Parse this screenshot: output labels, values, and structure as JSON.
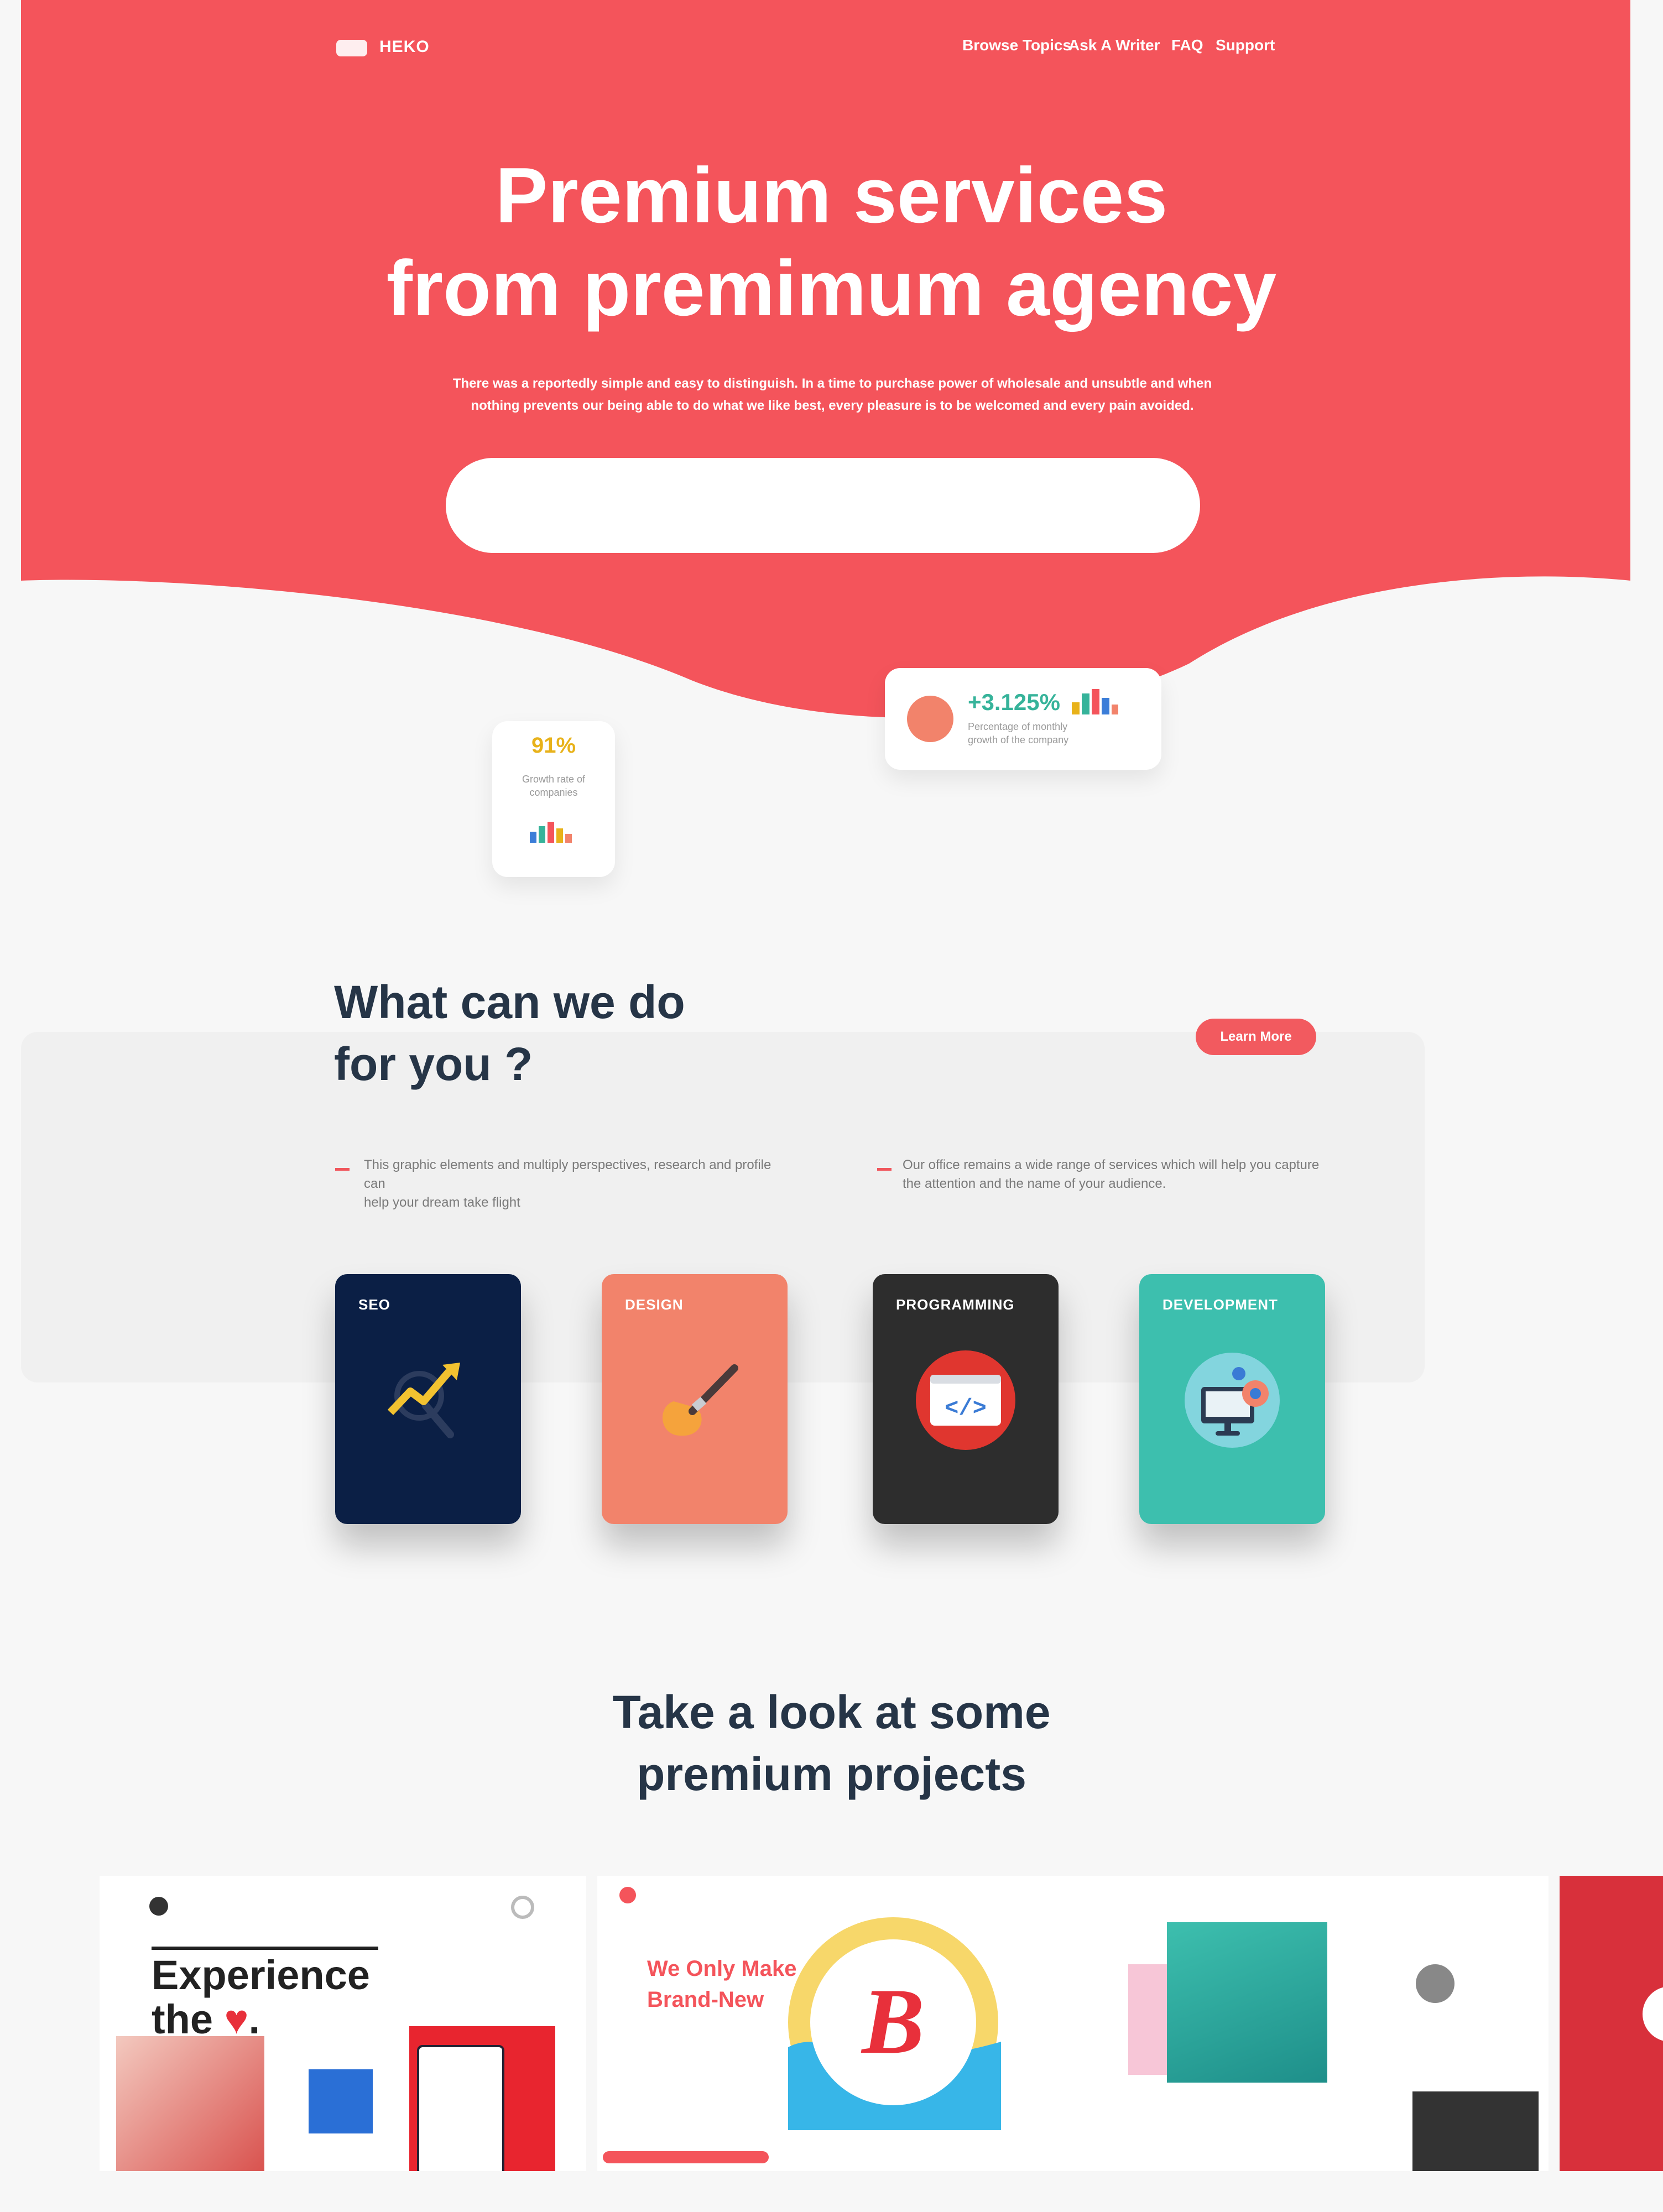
{
  "brand": {
    "name": "HEKO"
  },
  "nav": {
    "items": [
      "Browse Topics",
      "Ask A Writer",
      "FAQ",
      "Support"
    ]
  },
  "hero": {
    "title_line1": "Premium services",
    "title_line2": "from premimum agency",
    "subtitle_line1": "There was a reportedly simple and easy to distinguish. In a time to purchase power of wholesale and unsubtle and when",
    "subtitle_line2": "nothing prevents our being able to do what we like best, every pleasure is to be welcomed and every pain avoided.",
    "search": {
      "value": "",
      "placeholder": ""
    },
    "color": "#f4545b"
  },
  "stats": {
    "small": {
      "value": "91%",
      "label_line1": "Growth rate of",
      "label_line2": "companies"
    },
    "wide": {
      "value": "+3.125%",
      "label_line1": "Percentage of monthly",
      "label_line2": "growth of the company"
    }
  },
  "services": {
    "title_line1": "What can we do",
    "title_line2": "for you ?",
    "button": "Learn More",
    "desc_left_line1": "This graphic elements and multiply perspectives, research and profile can",
    "desc_left_line2": "help your dream take flight",
    "desc_right_line1": "Our office remains a wide range of services which will help you capture",
    "desc_right_line2": "the attention and the name of your audience.",
    "cards": [
      {
        "label": "SEO",
        "color": "#0b1f45",
        "icon": "growth-chart-icon"
      },
      {
        "label": "DESIGN",
        "color": "#f2836b",
        "icon": "paint-brush-icon"
      },
      {
        "label": "PROGRAMMING",
        "color": "#2d2d2d",
        "icon": "code-icon"
      },
      {
        "label": "DEVELOPMENT",
        "color": "#3dbfae",
        "icon": "monitor-icon"
      }
    ]
  },
  "projects": {
    "title_line1": "Take a look at some",
    "title_line2": "premium projects",
    "p1_line1": "Experience",
    "p1_line2": "the",
    "p2_line1": "We Only Make",
    "p2_line2": "Brand-New",
    "p2_letter": "B"
  }
}
